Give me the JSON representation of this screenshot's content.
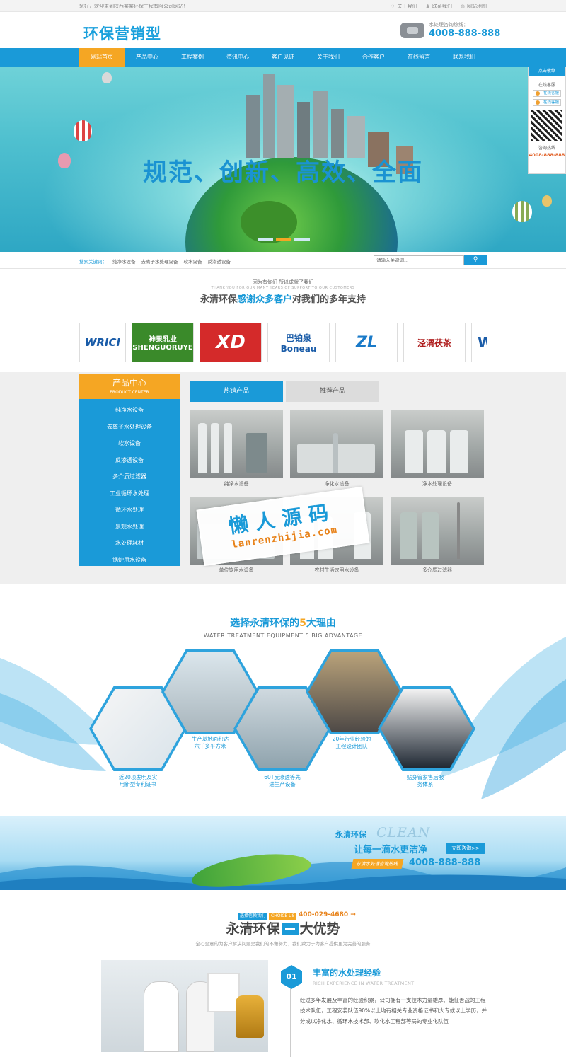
{
  "topbar": {
    "welcome": "您好，欢迎来到陕西某某环保工程有限公司网站！",
    "links": [
      {
        "icon": "compass-icon",
        "label": "关于我们"
      },
      {
        "icon": "user-icon",
        "label": "联系我们"
      },
      {
        "icon": "globe-icon",
        "label": "网站地图"
      }
    ]
  },
  "header": {
    "logo": "环保营销型",
    "hotline_label": "水处理咨询热线：",
    "hotline": "4008-888-888",
    "phone_icon": "telephone-icon"
  },
  "nav": {
    "items": [
      "网站首页",
      "产品中心",
      "工程案例",
      "资讯中心",
      "客户见证",
      "关于我们",
      "合作客户",
      "在线留言",
      "联系我们"
    ],
    "active_index": 0
  },
  "banner": {
    "slogan": "规范、创新、高效、全面",
    "slides": 3,
    "active_slide": 1
  },
  "float_service": {
    "header": "点击收缩",
    "title": "在线客服",
    "qq1": "在线客服",
    "qq2": "在线客服",
    "hotline_label": "咨询热线",
    "hotline": "4008-888-888"
  },
  "search": {
    "label": "搜索关键词：",
    "keywords": [
      "纯净水设备",
      "去离子水处理设备",
      "软水设备",
      "反渗透设备"
    ],
    "placeholder": "请输入关键词...",
    "button_icon": "search-icon"
  },
  "thanks": {
    "line1": "因为有你们  所以成就了我们",
    "line2": "THANK YOU FOR OUR MANY YEARS OF SUPPORT TO OUR CUSTOMERS",
    "title_a": "永清环保",
    "title_b": "感谢众多客户",
    "title_c": "对我们的多年支持"
  },
  "brands": [
    {
      "text": "WRICI",
      "color": "#1a5ca8",
      "bg": "#ffffff"
    },
    {
      "text": "神果乳业 SHENGUORUYE",
      "color": "#ffffff",
      "bg": "#3a8a2a"
    },
    {
      "text": "XD",
      "color": "#ffffff",
      "bg": "#d42a2a"
    },
    {
      "text": "巴铂泉 Boneau",
      "color": "#1a5ca8",
      "bg": "#ffffff"
    },
    {
      "text": "ZL",
      "color": "#1a7ac8",
      "bg": "#ffffff"
    },
    {
      "text": "泾渭茯茶",
      "color": "#b02020",
      "bg": "#ffffff"
    },
    {
      "text": "W",
      "color": "#1a5ca8",
      "bg": "#ffffff"
    }
  ],
  "product_center": {
    "title": "产品中心",
    "subtitle": "PRODUCT CENTER",
    "items": [
      "纯净水设备",
      "去离子水处理设备",
      "软水设备",
      "反渗透设备",
      "多介质过滤器",
      "工业循环水处理",
      "循环水处理",
      "景观水处理",
      "水处理耗材",
      "锅炉用水设备"
    ]
  },
  "tabs": [
    "热销产品",
    "推荐产品"
  ],
  "products": [
    "纯净水设备",
    "净化水设备",
    "净水处理设备",
    "单位饮用水设备",
    "农村生活饮用水设备",
    "多介质过滤器"
  ],
  "watermark": {
    "title": "懒人源码",
    "url": "lanrenzhijia.com"
  },
  "advantages": {
    "title_a": "选择永清环保的",
    "title_num": "5",
    "title_b": "大理由",
    "subtitle": "WATER TREATMENT EQUIPMENT 5 BIG ADVANTAGE",
    "items": [
      {
        "l1": "近20项发明及实",
        "l2": "用新型专利证书"
      },
      {
        "l1": "生产基地面积达",
        "l2": "六千多平方米"
      },
      {
        "l1": "60T反渗透等先",
        "l2": "进生产设备"
      },
      {
        "l1": "20年行业经验的",
        "l2": "工程设计团队"
      },
      {
        "l1": "贴身管家售后服",
        "l2": "务体系"
      }
    ]
  },
  "clean_banner": {
    "brand": "永清环保",
    "en": "CLEAN",
    "slogan": "让每一滴水更洁净",
    "button": "立即咨询>>",
    "tag": "永清水处理咨询热线",
    "hotline": "4008-888-888"
  },
  "advantage2": {
    "chip1": "选择信赖我们",
    "chip2": "CHOICE US",
    "phone": "400-029-4680 →",
    "title_a": "永清环保",
    "title_b": "大优势",
    "sub": "全心全意的为客户解决问题是我们的不懈努力，我们致力于为客户提供更为完善的服务",
    "badge": "01",
    "item_title": "丰富的水处理经验",
    "item_en": "RICH EXPERIENCE IN WATER TREATMENT",
    "item_text": "经过多年发展及丰富的经验积累，公司拥有一支技术力量雄厚、能征善战的工程技术队伍，工程安装队伍90%以上均有相关专业资格证书和大专或以上学历，并分成以净化水、循环水技术部、软化水工程部等局的专业化队伍"
  }
}
